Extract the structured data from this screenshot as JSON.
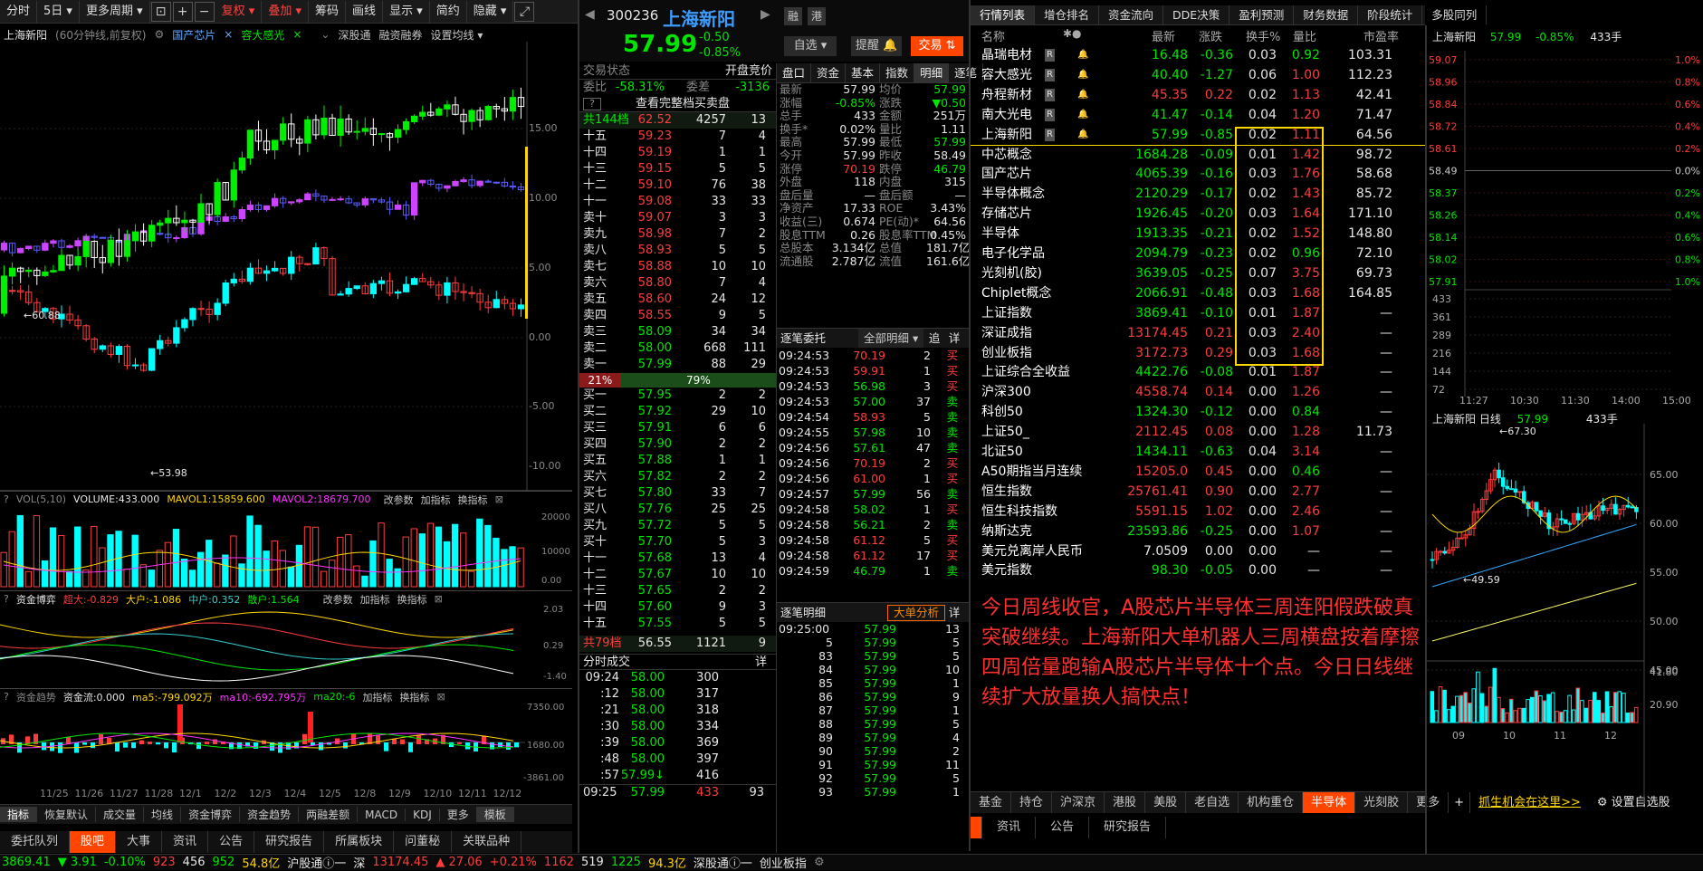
{
  "toolbar": {
    "items": [
      "分时",
      "5日",
      "更多周期",
      "复权",
      "叠加",
      "筹码",
      "画线",
      "显示",
      "简约",
      "隐藏"
    ]
  },
  "kinfo": {
    "name": "上海新阳",
    "period": "(60分钟线,前复权)",
    "overlay1": "国产芯片",
    "overlay2": "容大感光",
    "tools": [
      "深股通",
      "融资融券",
      "设置均线"
    ]
  },
  "kchart": {
    "hi_label": "60.88",
    "lo_label": "53.98",
    "right_axis": [
      "15.00",
      "10.00",
      "5.00",
      "0.00",
      "-5.00",
      "-10.00"
    ],
    "x_labels": [
      "11/25",
      "11/26",
      "11/27",
      "11/28",
      "12/1",
      "12/2",
      "12/3",
      "12/4",
      "12/5",
      "12/8",
      "12/9",
      "12/10",
      "12/11",
      "12/12"
    ]
  },
  "vol": {
    "title": "VOL(5,10)",
    "v1": "VOLUME:433.000",
    "v2": "MAVOL1:15859.600",
    "v3": "MAVOL2:18679.700",
    "btns": [
      "改参数",
      "加指标",
      "换指标"
    ],
    "axis": [
      "20000",
      "10000",
      "0.00"
    ]
  },
  "fund": {
    "title": "资金博弈",
    "a": "超大:-0.829",
    "b": "大户:-1.086",
    "c": "中户:0.352",
    "d": "散户:1.564",
    "btns": [
      "改参数",
      "加指标",
      "换指标"
    ],
    "axis": [
      "2.03",
      "0.29",
      "-1.40"
    ]
  },
  "flow": {
    "title": "资金趋势",
    "a": "资金流:0.000",
    "b": "ma5:-799.092万",
    "c": "ma10:-692.795万",
    "d": "ma20:-6",
    "btns": [
      "加指标",
      "换指标"
    ],
    "axis": [
      "7350.00",
      "1680.00",
      "-3861.00"
    ]
  },
  "leftbottom": [
    "指标",
    "恢复默认",
    "成交量",
    "均线",
    "资金博弈",
    "资金趋势",
    "两融差额",
    "MACD",
    "KDJ",
    "更多",
    "模板"
  ],
  "leftbottom2": [
    "委托队列",
    "股吧",
    "大事",
    "资讯",
    "公告",
    "研究报告",
    "所属板块",
    "问董秘",
    "关联品种"
  ],
  "quote": {
    "code": "300236",
    "name": "上海新阳",
    "price": "57.99",
    "chg": "-0.50",
    "pct": "-0.85%",
    "btn1": "融",
    "btn2": "港",
    "sel": "自选",
    "alert": "提醒",
    "trade": "交易"
  },
  "ob": {
    "status": "交易状态",
    "status_v": "开盘竞价",
    "wb": "委比",
    "wb_v": "-58.31%",
    "wc": "委差",
    "wc_v": "-3136",
    "view_all": "查看完整档买卖盘",
    "top": {
      "l": "共144档",
      "p": "62.52",
      "v": "4257",
      "n": "13"
    },
    "asks": [
      [
        "十五",
        "59.23",
        "7",
        "4"
      ],
      [
        "十四",
        "59.19",
        "1",
        "1"
      ],
      [
        "十三",
        "59.15",
        "5",
        "5"
      ],
      [
        "十二",
        "59.10",
        "76",
        "38"
      ],
      [
        "十一",
        "59.08",
        "33",
        "33"
      ],
      [
        "卖十",
        "59.07",
        "3",
        "3"
      ],
      [
        "卖九",
        "58.98",
        "7",
        "2"
      ],
      [
        "卖八",
        "58.93",
        "5",
        "5"
      ],
      [
        "卖七",
        "58.88",
        "10",
        "10"
      ],
      [
        "卖六",
        "58.80",
        "7",
        "4"
      ],
      [
        "卖五",
        "58.60",
        "24",
        "12"
      ],
      [
        "卖四",
        "58.55",
        "9",
        "5"
      ],
      [
        "卖三",
        "58.09",
        "34",
        "34"
      ],
      [
        "卖二",
        "58.00",
        "668",
        "111"
      ],
      [
        "卖一",
        "57.99",
        "88",
        "29"
      ]
    ],
    "ratio_l": "21%",
    "ratio_r": "79%",
    "bids": [
      [
        "买一",
        "57.95",
        "2",
        "2"
      ],
      [
        "买二",
        "57.92",
        "29",
        "10"
      ],
      [
        "买三",
        "57.91",
        "6",
        "6"
      ],
      [
        "买四",
        "57.90",
        "2",
        "2"
      ],
      [
        "买五",
        "57.88",
        "1",
        "1"
      ],
      [
        "买六",
        "57.82",
        "2",
        "2"
      ],
      [
        "买七",
        "57.80",
        "33",
        "7"
      ],
      [
        "买八",
        "57.76",
        "25",
        "25"
      ],
      [
        "买九",
        "57.72",
        "5",
        "5"
      ],
      [
        "买十",
        "57.70",
        "5",
        "3"
      ],
      [
        "十一",
        "57.68",
        "13",
        "4"
      ],
      [
        "十二",
        "57.67",
        "10",
        "10"
      ],
      [
        "十三",
        "57.65",
        "2",
        "2"
      ],
      [
        "十四",
        "57.60",
        "9",
        "3"
      ],
      [
        "十五",
        "57.55",
        "5",
        "5"
      ]
    ],
    "bottom": {
      "l": "共79档",
      "p": "56.55",
      "v": "1121",
      "n": "9"
    }
  },
  "fs": {
    "title": "分时成交",
    "detail": "详",
    "rows": [
      [
        "09:24",
        "58.00",
        "300"
      ],
      [
        ":12",
        "58.00",
        "317"
      ],
      [
        ":21",
        "58.00",
        "318"
      ],
      [
        ":30",
        "58.00",
        "334"
      ],
      [
        ":39",
        "58.00",
        "369"
      ],
      [
        ":48",
        "58.00",
        "397"
      ],
      [
        ":57",
        "57.99↓",
        "416"
      ]
    ],
    "last": [
      "09:25",
      "57.99",
      "433",
      "93"
    ]
  },
  "mkt": {
    "tabs": [
      "盘口",
      "资金",
      "基本",
      "指数",
      "明细",
      "逐笔"
    ],
    "rows": [
      [
        "最新",
        "57.99",
        "均价",
        "57.99"
      ],
      [
        "涨幅",
        "-0.85%",
        "涨跌",
        "▼0.50"
      ],
      [
        "总手",
        "433",
        "金额",
        "251万"
      ],
      [
        "换手*",
        "0.02%",
        "量比",
        "1.11"
      ],
      [
        "最高",
        "57.99",
        "最低",
        "57.99"
      ],
      [
        "今开",
        "57.99",
        "昨收",
        "58.49"
      ],
      [
        "涨停",
        "70.19",
        "跌停",
        "46.79"
      ],
      [
        "外盘",
        "118",
        "内盘",
        "315"
      ],
      [
        "盘后量",
        "—",
        "盘后额",
        "—"
      ],
      [
        "净资产",
        "17.33",
        "ROE",
        "3.43%"
      ],
      [
        "收益(三)",
        "0.674",
        "PE(动)*",
        "64.56"
      ],
      [
        "股息TTM",
        "0.26",
        "股息率TTM",
        "0.45%"
      ],
      [
        "总股本",
        "3.134亿",
        "总值",
        "181.7亿"
      ],
      [
        "流通股",
        "2.787亿",
        "流值",
        "161.6亿"
      ]
    ]
  },
  "zb": {
    "title": "逐笔委托",
    "sel": "全部明细",
    "b1": "追",
    "b2": "详",
    "rows": [
      [
        "09:24:53",
        "70.19",
        "2",
        "买"
      ],
      [
        "09:24:53",
        "59.91",
        "1",
        "买"
      ],
      [
        "09:24:53",
        "56.98",
        "3",
        "买"
      ],
      [
        "09:24:53",
        "57.00",
        "37",
        "卖"
      ],
      [
        "09:24:54",
        "58.93",
        "5",
        "卖"
      ],
      [
        "09:24:55",
        "57.98",
        "10",
        "卖"
      ],
      [
        "09:24:56",
        "57.61",
        "47",
        "卖"
      ],
      [
        "09:24:56",
        "70.19",
        "2",
        "买"
      ],
      [
        "09:24:56",
        "61.00",
        "1",
        "买"
      ],
      [
        "09:24:57",
        "57.99",
        "56",
        "卖"
      ],
      [
        "09:24:58",
        "58.02",
        "1",
        "买"
      ],
      [
        "09:24:58",
        "56.21",
        "2",
        "卖"
      ],
      [
        "09:24:58",
        "61.12",
        "5",
        "买"
      ],
      [
        "09:24:58",
        "61.12",
        "17",
        "买"
      ],
      [
        "09:24:59",
        "46.79",
        "1",
        "卖"
      ]
    ]
  },
  "zbmx": {
    "title": "逐笔明细",
    "btn": "大单分析",
    "b2": "详",
    "rows": [
      [
        "09:25:00",
        "57.99",
        "13"
      ],
      [
        "5",
        "57.99",
        "5"
      ],
      [
        "83",
        "57.99",
        "5"
      ],
      [
        "84",
        "57.99",
        "10"
      ],
      [
        "85",
        "57.99",
        "1"
      ],
      [
        "86",
        "57.99",
        "9"
      ],
      [
        "87",
        "57.99",
        "1"
      ],
      [
        "88",
        "57.99",
        "5"
      ],
      [
        "89",
        "57.99",
        "4"
      ],
      [
        "90",
        "57.99",
        "2"
      ],
      [
        "91",
        "57.99",
        "11"
      ],
      [
        "92",
        "57.99",
        "5"
      ],
      [
        "93",
        "57.99",
        "1"
      ]
    ]
  },
  "list": {
    "tabs": [
      "行情列表",
      "增仓排名",
      "资金流向",
      "DDE决策",
      "盈利预测",
      "财务数据",
      "阶段统计",
      "多股同列"
    ],
    "head": [
      "名称",
      "最新",
      "涨跌",
      "换手%",
      "量比",
      "市盈率"
    ],
    "rows": [
      [
        "晶瑞电材",
        "16.48",
        "-0.36",
        "0.03",
        "0.92",
        "103.31"
      ],
      [
        "容大感光",
        "40.40",
        "-1.27",
        "0.06",
        "1.00",
        "112.23"
      ],
      [
        "舟程新材",
        "45.35",
        "0.22",
        "0.02",
        "1.13",
        "42.41"
      ],
      [
        "南大光电",
        "41.47",
        "-0.14",
        "0.04",
        "1.20",
        "71.47"
      ],
      [
        "上海新阳",
        "57.99",
        "-0.85",
        "0.02",
        "1.11",
        "64.56"
      ],
      [
        "中芯概念",
        "1684.28",
        "-0.09",
        "0.01",
        "1.42",
        "98.72"
      ],
      [
        "国产芯片",
        "4065.39",
        "-0.16",
        "0.03",
        "1.76",
        "58.68"
      ],
      [
        "半导体概念",
        "2120.29",
        "-0.17",
        "0.02",
        "1.43",
        "85.72"
      ],
      [
        "存储芯片",
        "1926.45",
        "-0.20",
        "0.03",
        "1.64",
        "171.10"
      ],
      [
        "半导体",
        "1913.35",
        "-0.21",
        "0.02",
        "1.52",
        "148.80"
      ],
      [
        "电子化学品",
        "2094.79",
        "-0.23",
        "0.02",
        "0.96",
        "72.10"
      ],
      [
        "光刻机(胶)",
        "3639.05",
        "-0.25",
        "0.07",
        "3.75",
        "69.73"
      ],
      [
        "Chiplet概念",
        "2066.91",
        "-0.48",
        "0.03",
        "1.68",
        "164.85"
      ],
      [
        "上证指数",
        "3869.41",
        "-0.10",
        "0.01",
        "1.87",
        "—"
      ],
      [
        "深证成指",
        "13174.45",
        "0.21",
        "0.03",
        "2.40",
        "—"
      ],
      [
        "创业板指",
        "3172.73",
        "0.29",
        "0.03",
        "1.68",
        "—"
      ],
      [
        "上证综合全收益",
        "4422.76",
        "-0.08",
        "0.01",
        "1.87",
        "—"
      ],
      [
        "沪深300",
        "4558.74",
        "0.14",
        "0.00",
        "1.26",
        "—"
      ],
      [
        "科创50",
        "1324.30",
        "-0.12",
        "0.00",
        "0.84",
        "—"
      ],
      [
        "上证50_",
        "2112.45",
        "0.08",
        "0.00",
        "1.28",
        "11.73"
      ],
      [
        "北证50",
        "1434.11",
        "-0.63",
        "0.04",
        "3.14",
        "—"
      ],
      [
        "A50期指当月连续",
        "15205.0",
        "0.45",
        "0.00",
        "0.46",
        "—"
      ],
      [
        "恒生指数",
        "25761.41",
        "0.90",
        "0.00",
        "2.77",
        "—"
      ],
      [
        "恒生科技指数",
        "5591.15",
        "1.02",
        "0.00",
        "2.46",
        "—"
      ],
      [
        "纳斯达克",
        "23593.86",
        "-0.25",
        "0.00",
        "1.07",
        "—"
      ],
      [
        "美元兑离岸人民币",
        "7.0509",
        "0.00",
        "0.00",
        "—",
        "—"
      ],
      [
        "美元指数",
        "98.30",
        "-0.05",
        "0.00",
        "—",
        "—"
      ]
    ],
    "comment": "今日周线收官，A股芯片半导体三周连阳假跌破真突破继续。上海新阳大单机器人三周横盘按着摩擦四周倍量跑输A股芯片半导体十个点。今日日线继续扩大放量换人搞快点！",
    "btabs": [
      "基金",
      "持仓",
      "沪深京",
      "港股",
      "美股",
      "老自选",
      "机构重仓",
      "半导体",
      "光刻胶",
      "更多"
    ],
    "btabs_active": "半导体",
    "promo": "抓生机会在这里>>",
    "settings": "设置自选股",
    "btabs2": [
      "资讯",
      "公告",
      "研究报告"
    ]
  },
  "mini": {
    "name": "上海新阳",
    "price": "57.99",
    "pct": "-0.85%",
    "vol": "433手",
    "lp": [
      "59.07",
      "58.96",
      "58.84",
      "58.72",
      "58.61",
      "58.49",
      "58.37",
      "58.26",
      "58.14",
      "58.02",
      "57.91"
    ],
    "rp": [
      "1.0%",
      "0.8%",
      "0.6%",
      "0.4%",
      "0.2%",
      "0.0%",
      "0.2%",
      "0.4%",
      "0.6%",
      "0.8%",
      "1.0%"
    ],
    "va": [
      "433",
      "361",
      "289",
      "216",
      "144",
      "72"
    ],
    "times": [
      "11:27",
      "10:30",
      "11:30",
      "14:00",
      "15:00"
    ],
    "daily": "上海新阳 日线",
    "d_price": "57.99",
    "d_vol": "433手",
    "d_hi": "67.30",
    "d_lo": "49.59",
    "d_axis": [
      "65.00",
      "60.00",
      "55.00",
      "50.00",
      "45.00"
    ],
    "dv_axis": [
      "41.80",
      "20.90"
    ],
    "d_months": [
      "09",
      "10",
      "11",
      "12"
    ]
  },
  "status": {
    "sh": "3869.41",
    "sh_chg": "▼ 3.91",
    "sh_pct": "-0.10%",
    "sh_up": "923",
    "sh_eq": "456",
    "sh_dn": "952",
    "sh_amt": "54.8亿",
    "hgt": "沪股通",
    "sz_lbl": "深",
    "sz": "13174.45",
    "sz_chg": "▲ 27.06",
    "sz_pct": "+0.21%",
    "sz_up": "1162",
    "sz_eq": "519",
    "sz_dn": "1225",
    "sz_amt": "94.3亿",
    "sgt": "深股通",
    "cy": "创业板指"
  },
  "colors": {
    "up": "#ff3c3c",
    "down": "#00e600",
    "accent": "#ff4500"
  }
}
